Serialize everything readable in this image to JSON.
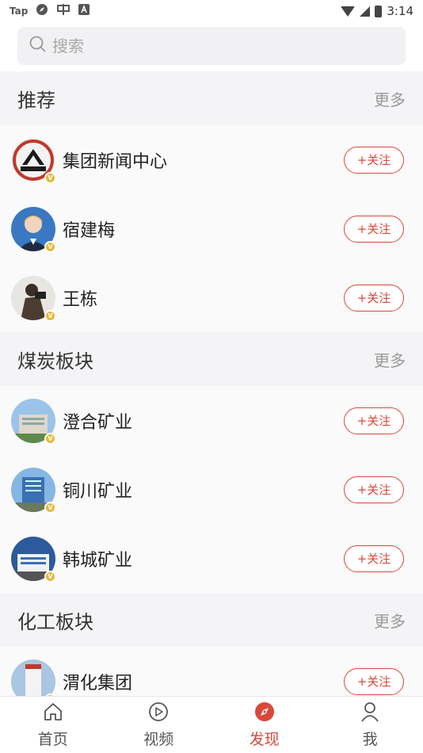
{
  "statusbar": {
    "left_icons": [
      "Tap",
      "compass-status-icon",
      "app-status-icon",
      "a-status-icon"
    ],
    "tap_label": "Tap",
    "time": "3:14"
  },
  "search": {
    "placeholder": "搜索"
  },
  "sections": [
    {
      "title": "推荐",
      "more": "更多",
      "items": [
        {
          "name": "集团新闻中心",
          "follow": "+关注",
          "avatar_color": "#c0392b"
        },
        {
          "name": "宿建梅",
          "follow": "+关注",
          "avatar_color": "#3a6fb0"
        },
        {
          "name": "王栋",
          "follow": "+关注",
          "avatar_color": "#5a4a3a"
        }
      ]
    },
    {
      "title": "煤炭板块",
      "more": "更多",
      "items": [
        {
          "name": "澄合矿业",
          "follow": "+关注",
          "avatar_color": "#6fa3d8"
        },
        {
          "name": "铜川矿业",
          "follow": "+关注",
          "avatar_color": "#4a86c5"
        },
        {
          "name": "韩城矿业",
          "follow": "+关注",
          "avatar_color": "#2f5f9e"
        }
      ]
    },
    {
      "title": "化工板块",
      "more": "更多",
      "items": [
        {
          "name": "渭化集团",
          "follow": "+关注",
          "avatar_color": "#7aa0c8"
        }
      ]
    }
  ],
  "tabbar": {
    "tabs": [
      {
        "label": "首页",
        "icon": "home-icon"
      },
      {
        "label": "视频",
        "icon": "play-icon"
      },
      {
        "label": "发现",
        "icon": "compass-icon",
        "active": true
      },
      {
        "label": "我",
        "icon": "person-icon"
      }
    ],
    "accent": "#d9473a"
  }
}
